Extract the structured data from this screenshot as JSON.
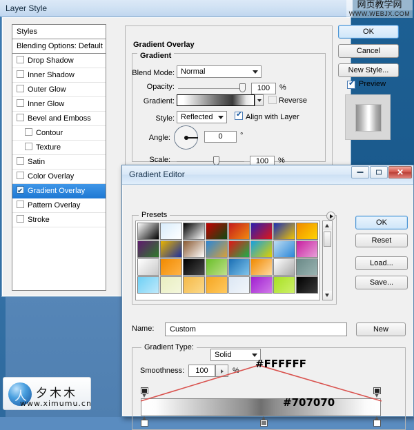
{
  "desktop": {
    "bg_left": "#5d8dbf",
    "bg_right": "#1a598c"
  },
  "layer_style": {
    "title": "Layer Style",
    "styles_panel": {
      "header": "Styles",
      "blending_options": "Blending Options: Default",
      "items": [
        {
          "label": "Drop Shadow",
          "checked": false,
          "indent": false
        },
        {
          "label": "Inner Shadow",
          "checked": false,
          "indent": false
        },
        {
          "label": "Outer Glow",
          "checked": false,
          "indent": false
        },
        {
          "label": "Inner Glow",
          "checked": false,
          "indent": false
        },
        {
          "label": "Bevel and Emboss",
          "checked": false,
          "indent": false
        },
        {
          "label": "Contour",
          "checked": false,
          "indent": true
        },
        {
          "label": "Texture",
          "checked": false,
          "indent": true
        },
        {
          "label": "Satin",
          "checked": false,
          "indent": false
        },
        {
          "label": "Color Overlay",
          "checked": false,
          "indent": false
        },
        {
          "label": "Gradient Overlay",
          "checked": true,
          "indent": false,
          "selected": true
        },
        {
          "label": "Pattern Overlay",
          "checked": false,
          "indent": false
        },
        {
          "label": "Stroke",
          "checked": false,
          "indent": false
        }
      ]
    },
    "panel": {
      "title": "Gradient Overlay",
      "group_title": "Gradient",
      "blend_mode_label": "Blend Mode:",
      "blend_mode_value": "Normal",
      "opacity_label": "Opacity:",
      "opacity_value": "100",
      "opacity_unit": "%",
      "gradient_label": "Gradient:",
      "reverse_label": "Reverse",
      "reverse_checked": false,
      "style_label": "Style:",
      "style_value": "Reflected",
      "align_label": "Align with Layer",
      "align_checked": true,
      "angle_label": "Angle:",
      "angle_value": "0",
      "angle_unit": "°",
      "scale_label": "Scale:",
      "scale_value": "100",
      "scale_unit": "%"
    },
    "buttons": {
      "ok": "OK",
      "cancel": "Cancel",
      "new_style": "New Style...",
      "preview": "Preview",
      "preview_checked": true
    }
  },
  "gradient_editor": {
    "title": "Gradient Editor",
    "presets_label": "Presets",
    "buttons": {
      "ok": "OK",
      "reset": "Reset",
      "load": "Load...",
      "save": "Save...",
      "new": "New"
    },
    "name_label": "Name:",
    "name_value": "Custom",
    "gradient_type_label": "Gradient Type:",
    "gradient_type_value": "Solid",
    "smoothness_label": "Smoothness:",
    "smoothness_value": "100",
    "smoothness_unit": "%",
    "swatches": [
      [
        "#ffffff,#000000",
        "#d8ecfb,#ffffff",
        "#000000,#ffffff",
        "#c40000,#0c4a12",
        "#c51b1b,#f08a10",
        "#2a1fb0,#e01616",
        "#1b2fb4,#f2c500",
        "#f08a00,#ffd400"
      ],
      [
        "#5f1a6e,#2f7a2a",
        "#e8b400,#1b2f9e",
        "#8a5a33,#ffffff",
        "#2a86d8,#d8a03a",
        "#e01616,#1bb04a",
        "#16a0e0,#e0d000",
        "#bcdcf2,#2a86d8",
        "#c81fa0,#e8a0d8"
      ],
      [
        "#ffffff,#c8c8c8",
        "#f08a00,#ffb347",
        "#000000,#4a4a4a",
        "#6abf2a,#bfe08a",
        "#1b6fb4,#7fc4ec",
        "#f08a00,#ffd9a0",
        "#ffffff,#a8a8a8",
        "#6b8a88,#9ab4b2"
      ],
      [
        "#6fd0f5,#bfe9fb",
        "#e8eec0,#f4f7dc",
        "#f5b947,#fbd98a",
        "#f5a623,#ffc95e",
        "#dce7f4,#f2f6fb",
        "#a020d0,#d07ae8",
        "#a8e024,#cdf06a",
        "#000000,#3a3a3a"
      ]
    ],
    "annotations": [
      {
        "text": "#FFFFFF",
        "color": "#000000"
      },
      {
        "text": "#707070",
        "color": "#000000"
      }
    ],
    "gradient_stops": {
      "top_left_color": "#222222",
      "top_right_color": "#222222",
      "bottom_left_color": "#ffffff",
      "bottom_mid_color": "#707070",
      "bottom_right_color": "#ffffff"
    },
    "titlebar_buttons": {
      "minimize": "minimize",
      "maximize": "maximize",
      "close": "✕"
    }
  },
  "watermarks": {
    "top_right_cn": "网页教学网",
    "top_right_url": "WWW.WEBJX.COM",
    "bottom_left_cn": "夕木木",
    "bottom_left_url": "www.ximumu.cn"
  }
}
